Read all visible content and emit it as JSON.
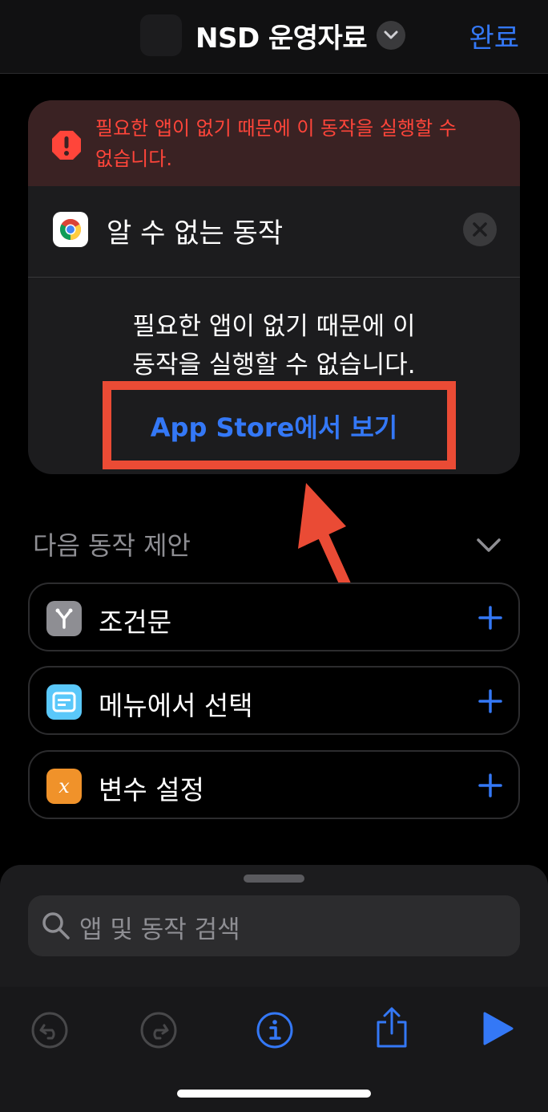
{
  "header": {
    "title": "NSD 운영자료",
    "done_label": "완료"
  },
  "card": {
    "error_message": "필요한 앱이 없기 때문에 이 동작을 실행할 수 없습니다.",
    "action_title": "알 수 없는 동작",
    "body_message_line1": "필요한 앱이 없기 때문에 이",
    "body_message_line2": "동작을 실행할 수 없습니다.",
    "appstore_label": "App Store에서 보기"
  },
  "suggestions": {
    "title": "다음 동작 제안",
    "items": [
      {
        "label": "조건문",
        "icon": "branch-icon",
        "color": "#8e8e93"
      },
      {
        "label": "메뉴에서 선택",
        "icon": "menu-icon",
        "color": "#5ac8fa"
      },
      {
        "label": "변수 설정",
        "icon": "variable-x-icon",
        "color": "#f0922a"
      }
    ]
  },
  "sheet": {
    "search_placeholder": "앱 및 동작 검색"
  },
  "colors": {
    "accent": "#3478f6",
    "error": "#ff453a",
    "annotation": "#ea4b35"
  }
}
